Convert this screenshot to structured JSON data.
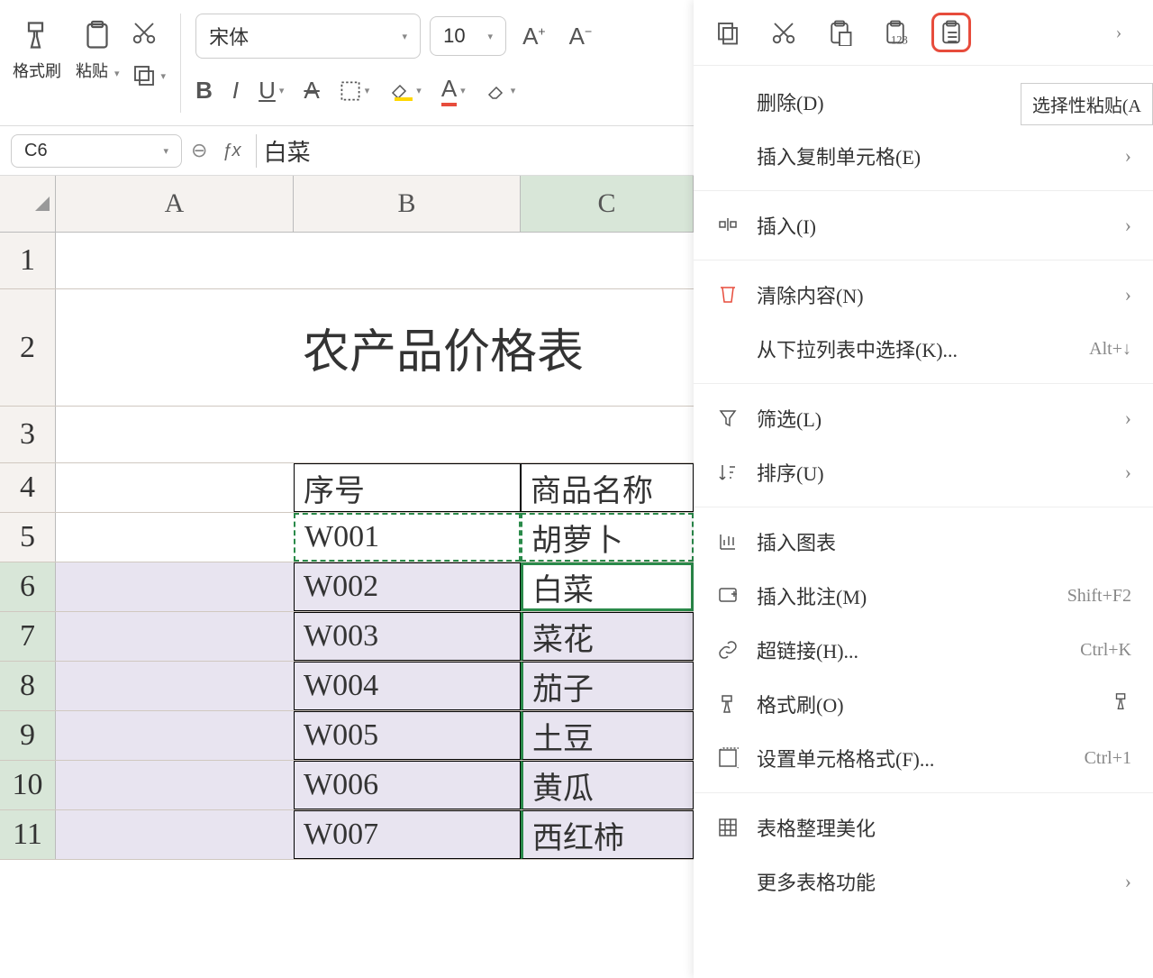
{
  "toolbar": {
    "format_painter": "格式刷",
    "paste": "粘贴",
    "font_name": "宋体",
    "font_size": "10"
  },
  "formula": {
    "cell_ref": "C6",
    "value": "白菜"
  },
  "columns": [
    "A",
    "B",
    "C"
  ],
  "rows": [
    "1",
    "2",
    "3",
    "4",
    "5",
    "6",
    "7",
    "8",
    "9",
    "10",
    "11"
  ],
  "title": "农产品价格表",
  "headers": {
    "b": "序号",
    "c": "商品名称"
  },
  "data": [
    {
      "b": "W001",
      "c": "胡萝卜"
    },
    {
      "b": "W002",
      "c": "白菜"
    },
    {
      "b": "W003",
      "c": "菜花"
    },
    {
      "b": "W004",
      "c": "茄子"
    },
    {
      "b": "W005",
      "c": "土豆"
    },
    {
      "b": "W006",
      "c": "黄瓜"
    },
    {
      "b": "W007",
      "c": "西红柿"
    }
  ],
  "ctx": {
    "tooltip": "选择性粘贴(A",
    "delete": "删除(D)",
    "insert_copy": "插入复制单元格(E)",
    "insert": "插入(I)",
    "clear": "清除内容(N)",
    "dropdown": "从下拉列表中选择(K)...",
    "dropdown_key": "Alt+↓",
    "filter": "筛选(L)",
    "sort": "排序(U)",
    "chart": "插入图表",
    "comment": "插入批注(M)",
    "comment_key": "Shift+F2",
    "link": "超链接(H)...",
    "link_key": "Ctrl+K",
    "painter": "格式刷(O)",
    "format": "设置单元格格式(F)...",
    "format_key": "Ctrl+1",
    "beautify": "表格整理美化",
    "more": "更多表格功能"
  }
}
